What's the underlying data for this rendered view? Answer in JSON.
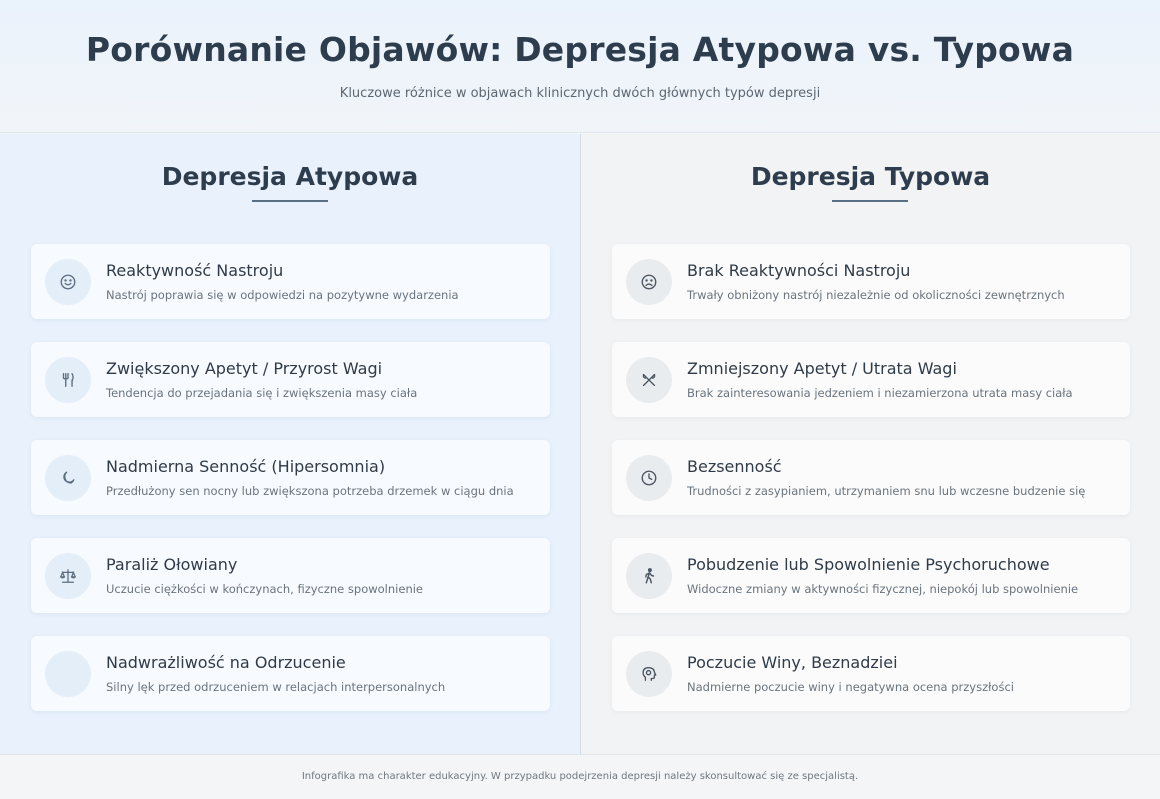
{
  "header": {
    "title": "Porównanie Objawów: Depresja Atypowa vs. Typowa",
    "subtitle": "Kluczowe różnice w objawach klinicznych dwóch głównych typów depresji"
  },
  "atypical": {
    "title": "Depresja Atypowa",
    "items": [
      {
        "icon": "smile-icon",
        "title": "Reaktywność Nastroju",
        "desc": "Nastrój poprawia się w odpowiedzi na pozytywne wydarzenia"
      },
      {
        "icon": "utensils-icon",
        "title": "Zwiększony Apetyt / Przyrost Wagi",
        "desc": "Tendencja do przejadania się i zwiększenia masy ciała"
      },
      {
        "icon": "moon-icon",
        "title": "Nadmierna Senność (Hipersomnia)",
        "desc": "Przedłużony sen nocny lub zwiększona potrzeba drzemek w ciągu dnia"
      },
      {
        "icon": "weight-scale-icon",
        "title": "Paraliż Ołowiany",
        "desc": "Uczucie ciężkości w kończynach, fizyczne spowolnienie"
      },
      {
        "icon": "",
        "title": "Nadwrażliwość na Odrzucenie",
        "desc": "Silny lęk przed odrzuceniem w relacjach interpersonalnych"
      }
    ]
  },
  "typical": {
    "title": "Depresja Typowa",
    "items": [
      {
        "icon": "frown-icon",
        "title": "Brak Reaktywności Nastroju",
        "desc": "Trwały obniżony nastrój niezależnie od okoliczności zewnętrznych"
      },
      {
        "icon": "crossed-utensils-icon",
        "title": "Zmniejszony Apetyt / Utrata Wagi",
        "desc": "Brak zainteresowania jedzeniem i niezamierzona utrata masy ciała"
      },
      {
        "icon": "clock-icon",
        "title": "Bezsenność",
        "desc": "Trudności z zasypianiem, utrzymaniem snu lub wczesne budzenie się"
      },
      {
        "icon": "walking-person-icon",
        "title": "Pobudzenie lub Spowolnienie Psychoruchowe",
        "desc": "Widoczne zmiany w aktywności fizycznej, niepokój lub spowolnienie"
      },
      {
        "icon": "head-brain-icon",
        "title": "Poczucie Winy, Beznadziei",
        "desc": "Nadmierne poczucie winy i negatywna ocena przyszłości"
      }
    ]
  },
  "footer": {
    "text": "Infografika ma charakter edukacyjny. W przypadku podejrzenia depresji należy skonsultować się ze specjalistą."
  }
}
